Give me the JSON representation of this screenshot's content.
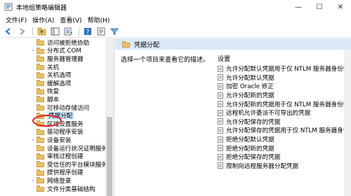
{
  "window": {
    "title": "本地组策略编辑器",
    "minimize": "—",
    "maximize": "☐",
    "close": "✕"
  },
  "menu": [
    "文件(F)",
    "操作(A)",
    "查看(V)",
    "帮助(H)"
  ],
  "toolbar": {
    "icons": [
      "back-icon",
      "forward-icon",
      "folder-up-icon",
      "show-hide-tree-icon",
      "export-list-icon",
      "help-icon",
      "properties-icon",
      "filter-icon"
    ]
  },
  "tree": {
    "items": [
      {
        "label": "访问被拒绝协助",
        "expand": "",
        "selected": false
      },
      {
        "label": "分布式 COM",
        "expand": "›",
        "selected": false
      },
      {
        "label": "服务器管理器",
        "expand": "",
        "selected": false
      },
      {
        "label": "关机",
        "expand": "",
        "selected": false
      },
      {
        "label": "关机选项",
        "expand": "",
        "selected": false
      },
      {
        "label": "缓解选项",
        "expand": "",
        "selected": false
      },
      {
        "label": "恢复",
        "expand": "",
        "selected": false
      },
      {
        "label": "脚本",
        "expand": "",
        "selected": false
      },
      {
        "label": "可移动存储访问",
        "expand": "",
        "selected": false
      },
      {
        "label": "凭据分配",
        "expand": "",
        "selected": true
      },
      {
        "label": "区域设置服务",
        "expand": "",
        "selected": false
      },
      {
        "label": "驱动程序安装",
        "expand": "",
        "selected": false
      },
      {
        "label": "设备安装",
        "expand": "›",
        "selected": false
      },
      {
        "label": "设备运行状况证明服务",
        "expand": "",
        "selected": false
      },
      {
        "label": "审核过程创建",
        "expand": "",
        "selected": false
      },
      {
        "label": "受信任的平台模块服务",
        "expand": "",
        "selected": false
      },
      {
        "label": "提供程序创建",
        "expand": "",
        "selected": false
      },
      {
        "label": "网络登录",
        "expand": "›",
        "selected": false
      },
      {
        "label": "文件分类基础结构",
        "expand": "",
        "selected": false
      }
    ]
  },
  "content": {
    "header": "凭据分配",
    "description": "选择一个项目来查看它的描述。",
    "section_heading": "设置",
    "settings": [
      "允许分配默认凭据用于仅 NTLM 服务器身份验证",
      "允许分配默认凭据",
      "加密 Oracle 修正",
      "允许分配新的凭据",
      "允许分配新的凭据用于仅 NTLM 服务器身份验证",
      "远程机允许委派不可导出的凭据",
      "允许分配保存的凭据",
      "允许分配保存的凭据用于仅 NTLM 服务器身份验证",
      "拒绝分配默认凭据",
      "拒绝分配新的凭据",
      "拒绝分配保存的凭据",
      "限制向远程服务器分配凭据"
    ]
  }
}
